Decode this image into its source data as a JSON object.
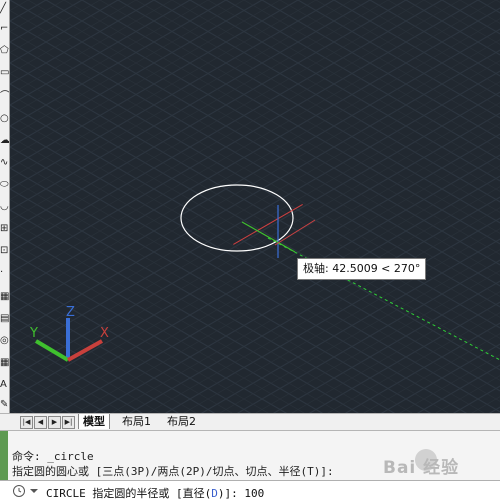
{
  "canvas": {
    "tooltip": "极轴: 42.5009 < 270°",
    "ucs_labels": {
      "x": "X",
      "y": "Y",
      "z": "Z"
    }
  },
  "tabs": {
    "items": [
      {
        "label": "模型",
        "active": true
      },
      {
        "label": "布局1",
        "active": false
      },
      {
        "label": "布局2",
        "active": false
      }
    ]
  },
  "command": {
    "history_1": "命令: _circle",
    "history_2": "指定圆的圆心或 [三点(3P)/两点(2P)/切点、切点、半径(T)]:",
    "current_prefix": "CIRCLE 指定圆的半径或 [直径(",
    "current_option": "D",
    "current_suffix": ")]: 100"
  },
  "watermark": "Bai 经验",
  "colors": {
    "canvas_bg": "#212830",
    "grid": "#2c3540",
    "circle": "#ffffff",
    "ucs_x": "#c8403c",
    "ucs_y": "#3fc02e",
    "ucs_z": "#3a6fd6",
    "tracking": "#2fcf37"
  },
  "icons": [
    "line-icon",
    "polyline-icon",
    "polygon-icon",
    "rectangle-icon",
    "arc-icon",
    "circle-icon",
    "revcloud-icon",
    "spline-icon",
    "ellipse-icon",
    "ellipse-arc-icon",
    "insert-block-icon",
    "make-block-icon",
    "point-icon",
    "hatch-icon",
    "gradient-icon",
    "region-icon",
    "table-icon",
    "mtext-icon",
    "add-selected-icon"
  ]
}
